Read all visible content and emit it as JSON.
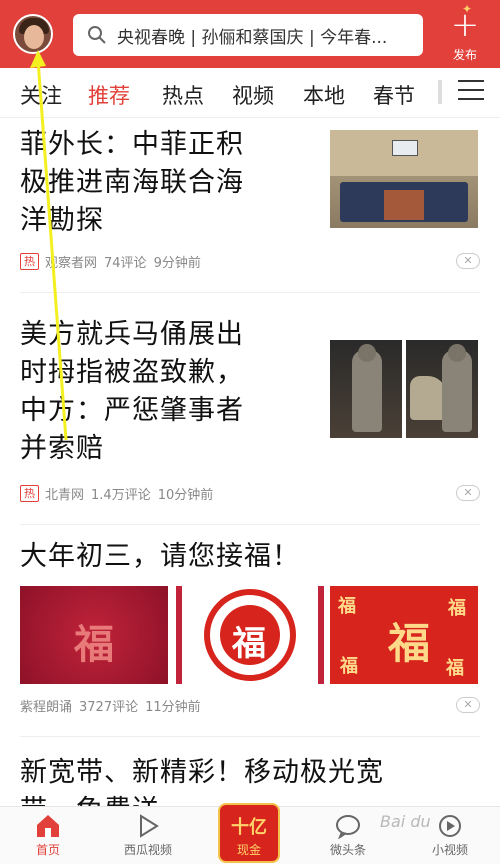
{
  "header": {
    "search_placeholder": "央视春晚 | 孙俪和蔡国庆 | 今年春...",
    "publish_label": "发布",
    "colors": {
      "brand": "#e2403a"
    }
  },
  "tabs": [
    "关注",
    "推荐",
    "热点",
    "视频",
    "本地",
    "春节"
  ],
  "active_tab": "推荐",
  "articles": [
    {
      "title_lines": [
        "菲外长：中菲正积",
        "极推进南海联合海",
        "洋勘探"
      ],
      "hot_label": "热",
      "source": "观察者网",
      "comments": "74评论",
      "time": "9分钟前"
    },
    {
      "title_lines": [
        "美方就兵马俑展出",
        "时拇指被盗致歉，",
        "中方：严惩肇事者",
        "并索赔"
      ],
      "hot_label": "热",
      "source": "北青网",
      "comments": "1.4万评论",
      "time": "10分钟前"
    },
    {
      "title_lines": [
        "大年初三，请您接福！"
      ],
      "fu_char": "福",
      "source": "紫程朗诵",
      "comments": "3727评论",
      "time": "11分钟前"
    },
    {
      "title_lines": [
        "新宽带、新精彩！移动极光宽",
        "带，免费送"
      ]
    }
  ],
  "dismiss_icon": "close-icon",
  "bottom_nav": [
    {
      "label": "首页",
      "icon": "home-icon"
    },
    {
      "label": "西瓜视频",
      "icon": "play-icon"
    },
    {
      "label": "现金",
      "big": "十亿",
      "icon": "cash-icon"
    },
    {
      "label": "微头条",
      "icon": "chat-bubble-icon"
    },
    {
      "label": "小视频",
      "icon": "short-video-icon"
    }
  ],
  "watermark": "Bai du"
}
